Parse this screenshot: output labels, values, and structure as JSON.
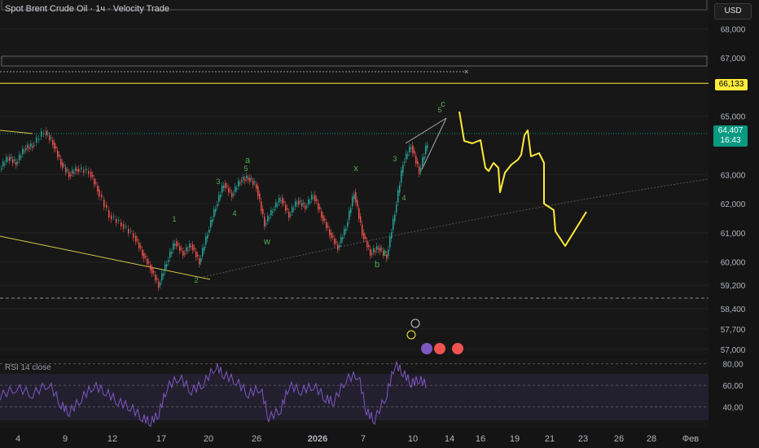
{
  "title": "Spot Brent Crude Oil · 1ч · Velocity Trade",
  "currency_button": "USD",
  "price_tag": "66,133",
  "current_price": "64,407",
  "countdown": "16:43",
  "rsi_label": "RSI 14 close",
  "chart_data": {
    "type": "candlestick",
    "price_axis": [
      "68,000",
      "67,000",
      "65,000",
      "63,000",
      "62,000",
      "61,000",
      "60,000",
      "59,200",
      "58,400",
      "57,700",
      "57,000"
    ],
    "rsi_axis": [
      "80,00",
      "60,00",
      "40,00"
    ],
    "x_ticks": [
      "4",
      "9",
      "12",
      "17",
      "20",
      "26",
      "2026",
      "7",
      "10",
      "14",
      "16",
      "19",
      "21",
      "23",
      "26",
      "28",
      "Фев"
    ],
    "price_series": [
      [
        0,
        63.2
      ],
      [
        10,
        63.6
      ],
      [
        20,
        63.4
      ],
      [
        30,
        63.9
      ],
      [
        40,
        64.0
      ],
      [
        55,
        64.5
      ],
      [
        65,
        64.1
      ],
      [
        75,
        63.4
      ],
      [
        85,
        63.0
      ],
      [
        95,
        63.2
      ],
      [
        110,
        63.1
      ],
      [
        120,
        62.5
      ],
      [
        135,
        61.6
      ],
      [
        150,
        61.3
      ],
      [
        165,
        60.9
      ],
      [
        175,
        60.3
      ],
      [
        185,
        59.8
      ],
      [
        195,
        59.2
      ],
      [
        205,
        60.0
      ],
      [
        215,
        60.7
      ],
      [
        225,
        60.3
      ],
      [
        235,
        60.6
      ],
      [
        245,
        60.0
      ],
      [
        255,
        61.0
      ],
      [
        265,
        61.9
      ],
      [
        275,
        62.7
      ],
      [
        285,
        62.3
      ],
      [
        295,
        62.8
      ],
      [
        305,
        62.9
      ],
      [
        315,
        62.6
      ],
      [
        325,
        61.3
      ],
      [
        335,
        61.8
      ],
      [
        345,
        62.2
      ],
      [
        355,
        61.6
      ],
      [
        365,
        62.1
      ],
      [
        375,
        61.9
      ],
      [
        385,
        62.3
      ],
      [
        395,
        61.6
      ],
      [
        405,
        61.0
      ],
      [
        415,
        60.5
      ],
      [
        425,
        61.2
      ],
      [
        435,
        62.4
      ],
      [
        445,
        61.0
      ],
      [
        455,
        60.3
      ],
      [
        465,
        60.5
      ],
      [
        475,
        60.2
      ],
      [
        485,
        61.7
      ],
      [
        495,
        63.4
      ],
      [
        505,
        64.0
      ],
      [
        515,
        63.1
      ],
      [
        525,
        64.1
      ]
    ],
    "price_range": [
      56.8,
      68.6
    ],
    "wave_labels": [
      "1",
      "2",
      "3",
      "4",
      "5",
      "a",
      "w",
      "x",
      "b",
      "2",
      "3",
      "4",
      "5",
      "c"
    ],
    "horizontal_levels": [
      {
        "price": 66.133,
        "color": "#ffeb3b"
      },
      {
        "price": 64.407,
        "color": "#089981"
      }
    ],
    "projection": [
      [
        564,
        137
      ],
      [
        570,
        173
      ],
      [
        580,
        176
      ],
      [
        590,
        172
      ],
      [
        596,
        206
      ],
      [
        600,
        210
      ],
      [
        606,
        200
      ],
      [
        612,
        206
      ],
      [
        614,
        236
      ],
      [
        620,
        212
      ],
      [
        628,
        202
      ],
      [
        636,
        196
      ],
      [
        640,
        190
      ],
      [
        644,
        166
      ],
      [
        648,
        160
      ],
      [
        652,
        192
      ],
      [
        662,
        188
      ],
      [
        668,
        200
      ],
      [
        668,
        250
      ],
      [
        680,
        258
      ],
      [
        682,
        284
      ],
      [
        694,
        302
      ],
      [
        720,
        260
      ]
    ],
    "rsi_series": [
      [
        0,
        50
      ],
      [
        20,
        58
      ],
      [
        40,
        52
      ],
      [
        60,
        62
      ],
      [
        75,
        42
      ],
      [
        85,
        35
      ],
      [
        100,
        48
      ],
      [
        115,
        60
      ],
      [
        130,
        54
      ],
      [
        145,
        45
      ],
      [
        160,
        40
      ],
      [
        175,
        30
      ],
      [
        185,
        26
      ],
      [
        195,
        34
      ],
      [
        205,
        58
      ],
      [
        220,
        68
      ],
      [
        235,
        55
      ],
      [
        250,
        62
      ],
      [
        265,
        78
      ],
      [
        275,
        70
      ],
      [
        290,
        64
      ],
      [
        305,
        52
      ],
      [
        320,
        58
      ],
      [
        330,
        30
      ],
      [
        345,
        38
      ],
      [
        355,
        60
      ],
      [
        370,
        55
      ],
      [
        385,
        60
      ],
      [
        400,
        48
      ],
      [
        410,
        45
      ],
      [
        425,
        66
      ],
      [
        440,
        70
      ],
      [
        450,
        36
      ],
      [
        460,
        28
      ],
      [
        475,
        52
      ],
      [
        485,
        80
      ],
      [
        495,
        72
      ],
      [
        505,
        62
      ],
      [
        515,
        66
      ],
      [
        525,
        60
      ]
    ],
    "rsi_range": [
      20,
      85
    ]
  }
}
